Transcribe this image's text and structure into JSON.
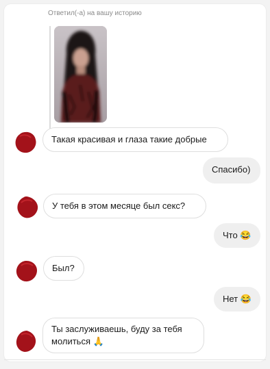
{
  "reply_context": {
    "label": "Ответил(-а) на вашу историю",
    "story_thumbnail": "blurred-portrait-photo"
  },
  "messages": [
    {
      "side": "incoming",
      "text": "Такая красивая и глаза такие добрые"
    },
    {
      "side": "outgoing",
      "text": "Спасибо)"
    },
    {
      "side": "incoming",
      "text": "У тебя в этом месяце был секс?"
    },
    {
      "side": "outgoing",
      "text": "Что 😂"
    },
    {
      "side": "incoming",
      "text": "Был?"
    },
    {
      "side": "outgoing",
      "text": "Нет 😂"
    },
    {
      "side": "incoming",
      "text_line1": "Ты заслуживаешь, буду за тебя",
      "text_line2": "молиться 🙏"
    }
  ],
  "colors": {
    "incoming_border": "#dedede",
    "outgoing_bubble": "#efefef",
    "avatar_redaction": "#a3121a"
  }
}
